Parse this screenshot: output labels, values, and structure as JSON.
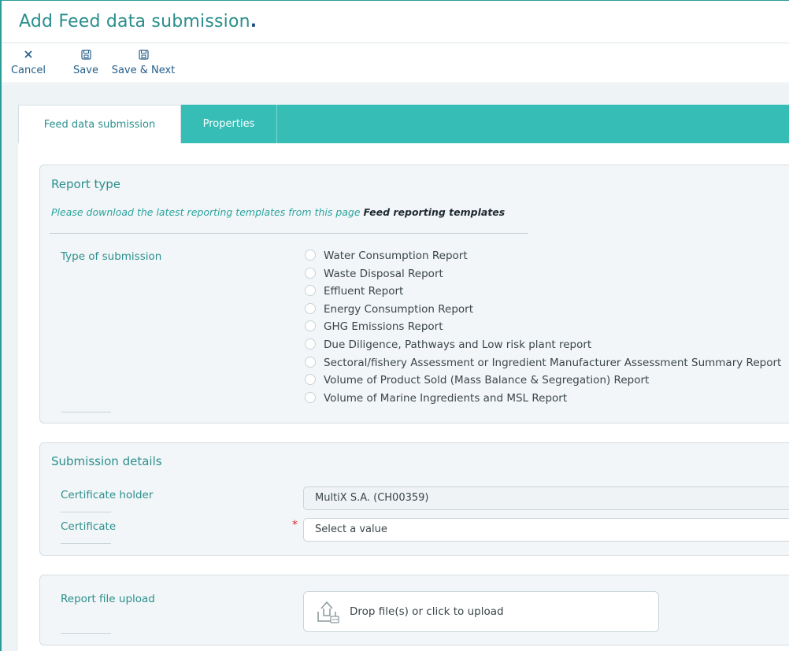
{
  "page": {
    "title": "Add Feed data submission",
    "title_dot": "."
  },
  "toolbar": {
    "cancel_label": "Cancel",
    "save_label": "Save",
    "save_next_label": "Save & Next"
  },
  "tabs": [
    {
      "label": "Feed data submission",
      "active": true
    },
    {
      "label": "Properties",
      "active": false
    }
  ],
  "report_type": {
    "heading": "Report type",
    "hint_text": "Please download the latest reporting templates from this page ",
    "hint_link": "Feed reporting templates",
    "type_label": "Type of submission",
    "options": [
      "Water Consumption Report",
      "Waste Disposal Report",
      "Effluent Report",
      "Energy Consumption Report",
      "GHG Emissions Report",
      "Due Diligence, Pathways and Low risk plant report",
      "Sectoral/fishery Assessment or Ingredient Manufacturer Assessment Summary Report",
      "Volume of Product Sold (Mass Balance & Segregation) Report",
      "Volume of Marine Ingredients and MSL Report"
    ]
  },
  "submission_details": {
    "heading": "Submission details",
    "certificate_holder_label": "Certificate holder",
    "certificate_holder_value": "MultiX S.A. (CH00359)",
    "certificate_label": "Certificate",
    "certificate_placeholder": "Select a value",
    "required_mark": "*"
  },
  "upload": {
    "label": "Report file upload",
    "drop_text": "Drop file(s) or click to upload"
  },
  "colors": {
    "accent": "#2a8f8c",
    "tab_bar": "#35bdb6",
    "link_blue": "#245e8a",
    "required": "#d9262c"
  }
}
